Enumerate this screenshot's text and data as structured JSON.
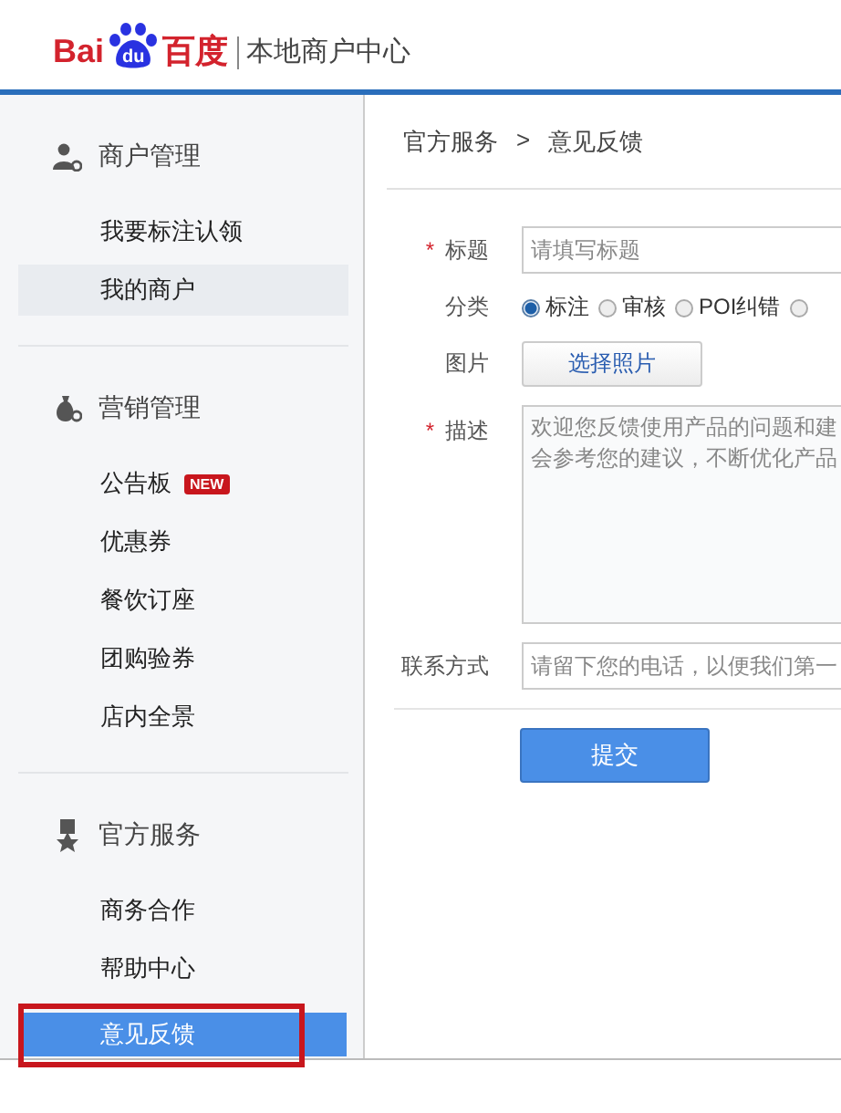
{
  "header": {
    "logo": {
      "left": "Bai",
      "paw": "du",
      "right": "百度"
    },
    "subtitle": "本地商户中心"
  },
  "sidebar": {
    "groups": [
      {
        "kind": "merchant",
        "title": "商户管理",
        "items": [
          {
            "label": "我要标注认领",
            "selected": false
          },
          {
            "label": "我的商户",
            "selected": false,
            "hover": true
          }
        ]
      },
      {
        "kind": "marketing",
        "title": "营销管理",
        "items": [
          {
            "label": "公告板",
            "selected": false,
            "badge": "NEW"
          },
          {
            "label": "优惠券",
            "selected": false
          },
          {
            "label": "餐饮订座",
            "selected": false
          },
          {
            "label": "团购验券",
            "selected": false
          },
          {
            "label": "店内全景",
            "selected": false
          }
        ]
      },
      {
        "kind": "official",
        "title": "官方服务",
        "items": [
          {
            "label": "商务合作",
            "selected": false
          },
          {
            "label": "帮助中心",
            "selected": false
          },
          {
            "label": "意见反馈",
            "selected": true,
            "annotated": true
          }
        ]
      }
    ]
  },
  "breadcrumb": [
    "官方服务",
    "意见反馈"
  ],
  "breadcrumb_separator": ">",
  "form": {
    "title": {
      "label": "标题",
      "required_mark": "*",
      "placeholder": "请填写标题"
    },
    "category": {
      "label": "分类",
      "options": [
        {
          "label": "标注",
          "selected": true
        },
        {
          "label": "审核",
          "selected": false
        },
        {
          "label": "POI纠错",
          "selected": false
        },
        {
          "selected": false
        }
      ]
    },
    "image": {
      "label": "图片",
      "button": "选择照片"
    },
    "description": {
      "label": "描述",
      "required_mark": "*",
      "placeholder": [
        "欢迎您反馈使用产品的问题和建",
        "会参考您的建议，不断优化产品"
      ]
    },
    "contact": {
      "label": "联系方式",
      "placeholder": "请留下您的电话，以便我们第一"
    },
    "submit": "提交"
  }
}
